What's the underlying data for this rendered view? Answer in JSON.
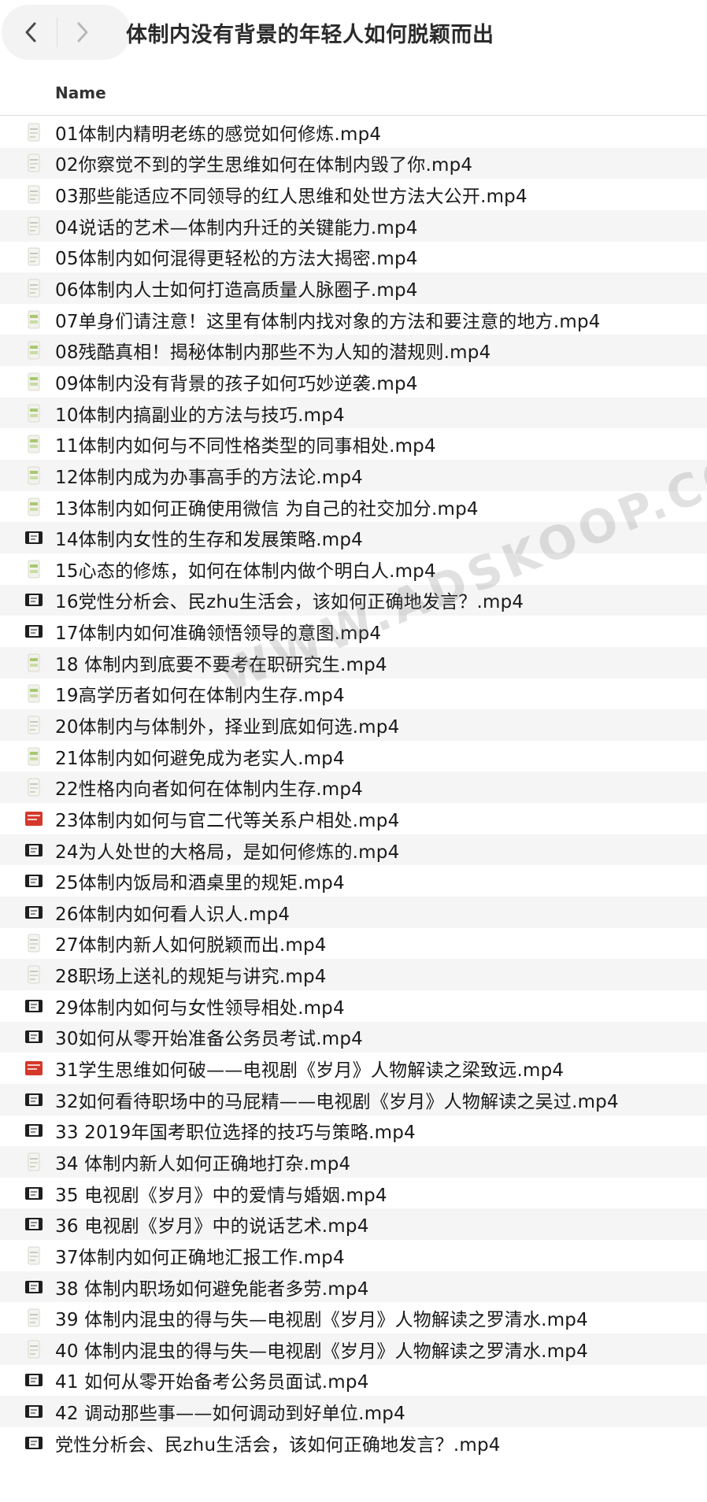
{
  "window": {
    "title": "体制内没有背景的年轻人如何脱颖而出"
  },
  "navigation": {
    "back_icon": "chevron-left-icon",
    "forward_icon": "chevron-right-icon"
  },
  "columns": {
    "name_header": "Name"
  },
  "watermark": {
    "text": "WWW.ADSKOOP.COM"
  },
  "colors": {
    "row_stripe": "#f5f5f5",
    "separator": "#dddddd"
  },
  "files": [
    {
      "name": "01体制内精明老练的感觉如何修炼.mp4",
      "icon": "video-file-icon",
      "thumb": "light"
    },
    {
      "name": "02你察觉不到的学生思维如何在体制内毁了你.mp4",
      "icon": "video-file-icon",
      "thumb": "light"
    },
    {
      "name": "03那些能适应不同领导的红人思维和处世方法大公开.mp4",
      "icon": "video-file-icon",
      "thumb": "light"
    },
    {
      "name": "04说话的艺术—体制内升迁的关键能力.mp4",
      "icon": "video-file-icon",
      "thumb": "light"
    },
    {
      "name": "05体制内如何混得更轻松的方法大揭密.mp4",
      "icon": "video-file-icon",
      "thumb": "light"
    },
    {
      "name": "06体制内人士如何打造高质量人脉圈子.mp4",
      "icon": "video-file-icon",
      "thumb": "light"
    },
    {
      "name": "07单身们请注意！这里有体制内找对象的方法和要注意的地方.mp4",
      "icon": "video-file-icon",
      "thumb": "green"
    },
    {
      "name": "08残酷真相！揭秘体制内那些不为人知的潜规则.mp4",
      "icon": "video-file-icon",
      "thumb": "green"
    },
    {
      "name": "09体制内没有背景的孩子如何巧妙逆袭.mp4",
      "icon": "video-file-icon",
      "thumb": "green"
    },
    {
      "name": "10体制内搞副业的方法与技巧.mp4",
      "icon": "video-file-icon",
      "thumb": "green"
    },
    {
      "name": "11体制内如何与不同性格类型的同事相处.mp4",
      "icon": "video-file-icon",
      "thumb": "green"
    },
    {
      "name": "12体制内成为办事高手的方法论.mp4",
      "icon": "video-file-icon",
      "thumb": "green"
    },
    {
      "name": "13体制内如何正确使用微信 为自己的社交加分.mp4",
      "icon": "video-file-icon",
      "thumb": "green"
    },
    {
      "name": "14体制内女性的生存和发展策略.mp4",
      "icon": "video-file-icon",
      "thumb": "dark"
    },
    {
      "name": "15心态的修炼，如何在体制内做个明白人.mp4",
      "icon": "video-file-icon",
      "thumb": "green"
    },
    {
      "name": "16党性分析会、民zhu生活会，该如何正确地发言？.mp4",
      "icon": "video-file-icon",
      "thumb": "dark"
    },
    {
      "name": "17体制内如何准确领悟领导的意图.mp4",
      "icon": "video-file-icon",
      "thumb": "dark"
    },
    {
      "name": "18 体制内到底要不要考在职研究生.mp4",
      "icon": "video-file-icon",
      "thumb": "green"
    },
    {
      "name": "19高学历者如何在体制内生存.mp4",
      "icon": "video-file-icon",
      "thumb": "green"
    },
    {
      "name": "20体制内与体制外，择业到底如何选.mp4",
      "icon": "video-file-icon",
      "thumb": "light"
    },
    {
      "name": "21体制内如何避免成为老实人.mp4",
      "icon": "video-file-icon",
      "thumb": "green"
    },
    {
      "name": "22性格内向者如何在体制内生存.mp4",
      "icon": "video-file-icon",
      "thumb": "light"
    },
    {
      "name": "23体制内如何与官二代等关系户相处.mp4",
      "icon": "video-file-icon",
      "thumb": "red"
    },
    {
      "name": "24为人处世的大格局，是如何修炼的.mp4",
      "icon": "video-file-icon",
      "thumb": "dark"
    },
    {
      "name": "25体制内饭局和酒桌里的规矩.mp4",
      "icon": "video-file-icon",
      "thumb": "dark"
    },
    {
      "name": "26体制内如何看人识人.mp4",
      "icon": "video-file-icon",
      "thumb": "dark"
    },
    {
      "name": "27体制内新人如何脱颖而出.mp4",
      "icon": "video-file-icon",
      "thumb": "light"
    },
    {
      "name": "28职场上送礼的规矩与讲究.mp4",
      "icon": "video-file-icon",
      "thumb": "light"
    },
    {
      "name": "29体制内如何与女性领导相处.mp4",
      "icon": "video-file-icon",
      "thumb": "dark"
    },
    {
      "name": "30如何从零开始准备公务员考试.mp4",
      "icon": "video-file-icon",
      "thumb": "dark"
    },
    {
      "name": "31学生思维如何破——电视剧《岁月》人物解读之梁致远.mp4",
      "icon": "video-file-icon",
      "thumb": "red"
    },
    {
      "name": "32如何看待职场中的马屁精——电视剧《岁月》人物解读之吴过.mp4",
      "icon": "video-file-icon",
      "thumb": "dark"
    },
    {
      "name": "33 2019年国考职位选择的技巧与策略.mp4",
      "icon": "video-file-icon",
      "thumb": "dark"
    },
    {
      "name": "34 体制内新人如何正确地打杂.mp4",
      "icon": "video-file-icon",
      "thumb": "light"
    },
    {
      "name": "35 电视剧《岁月》中的爱情与婚姻.mp4",
      "icon": "video-file-icon",
      "thumb": "dark"
    },
    {
      "name": "36 电视剧《岁月》中的说话艺术.mp4",
      "icon": "video-file-icon",
      "thumb": "dark"
    },
    {
      "name": "37体制内如何正确地汇报工作.mp4",
      "icon": "video-file-icon",
      "thumb": "light"
    },
    {
      "name": "38 体制内职场如何避免能者多劳.mp4",
      "icon": "video-file-icon",
      "thumb": "dark"
    },
    {
      "name": "39 体制内混虫的得与失—电视剧《岁月》人物解读之罗清水.mp4",
      "icon": "video-file-icon",
      "thumb": "light"
    },
    {
      "name": "40 体制内混虫的得与失—电视剧《岁月》人物解读之罗清水.mp4",
      "icon": "video-file-icon",
      "thumb": "light"
    },
    {
      "name": "41 如何从零开始备考公务员面试.mp4",
      "icon": "video-file-icon",
      "thumb": "dark"
    },
    {
      "name": "42 调动那些事——如何调动到好单位.mp4",
      "icon": "video-file-icon",
      "thumb": "dark"
    },
    {
      "name": "党性分析会、民zhu生活会，该如何正确地发言？.mp4",
      "icon": "video-file-icon",
      "thumb": "dark"
    }
  ]
}
